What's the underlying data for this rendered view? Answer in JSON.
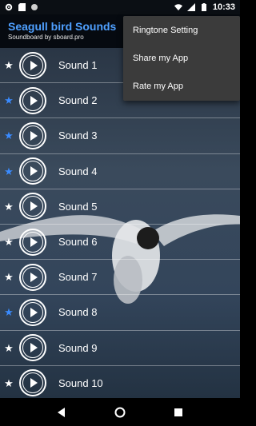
{
  "status_bar": {
    "time": "10:33",
    "left_icons": [
      "gear-icon",
      "sd-card-icon",
      "circle-icon"
    ],
    "right_icons": [
      "wifi-icon",
      "signal-icon",
      "battery-icon"
    ]
  },
  "app_bar": {
    "title": "Seagull bird Sounds",
    "subtitle": "Soundboard by sboard.pro"
  },
  "menu": {
    "items": [
      "Ringtone Setting",
      "Share my App",
      "Rate my App"
    ]
  },
  "sounds": [
    {
      "label": "Sound 1",
      "favorite": false
    },
    {
      "label": "Sound 2",
      "favorite": true
    },
    {
      "label": "Sound 3",
      "favorite": true
    },
    {
      "label": "Sound 4",
      "favorite": true
    },
    {
      "label": "Sound 5",
      "favorite": false
    },
    {
      "label": "Sound 6",
      "favorite": false
    },
    {
      "label": "Sound 7",
      "favorite": false
    },
    {
      "label": "Sound 8",
      "favorite": true
    },
    {
      "label": "Sound 9",
      "favorite": false
    },
    {
      "label": "Sound 10",
      "favorite": false
    }
  ],
  "colors": {
    "title": "#4fa0ff",
    "favorite_star": "#3a8bff",
    "star": "#ffffff",
    "menu_bg": "#3b3b3b"
  },
  "nav_bar": {
    "buttons": [
      "back-icon",
      "home-icon",
      "recents-icon"
    ]
  }
}
